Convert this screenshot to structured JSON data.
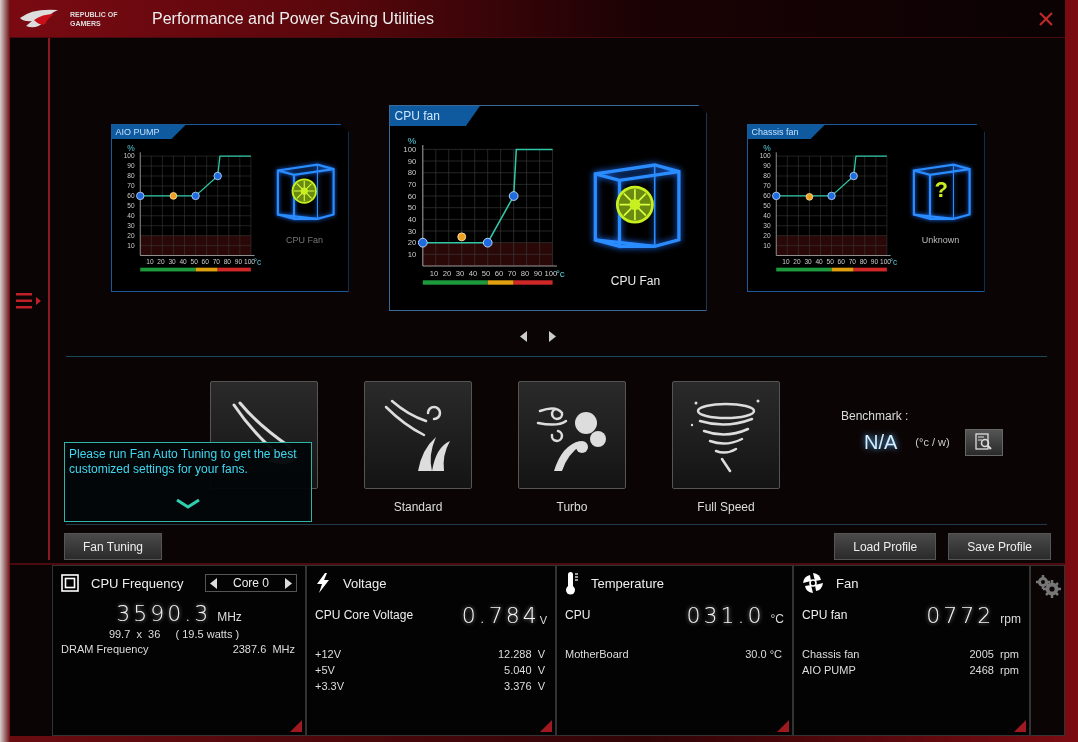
{
  "window": {
    "title": "Performance and Power Saving Utilities",
    "brand": "REPUBLIC OF GAMERS"
  },
  "fan_cards": [
    {
      "title": "AIO PUMP",
      "selected": false,
      "device": {
        "kind": "fan",
        "label": "CPU Fan",
        "dimmed": true
      },
      "chart_data": {
        "type": "line",
        "xlabel": "°c",
        "ylabel": "%",
        "grid": true,
        "x": [
          0,
          30,
          50,
          70,
          72,
          100
        ],
        "series": [
          {
            "color": "#2fc7a6",
            "values": [
              60,
              60,
              60,
              80,
              100,
              100
            ]
          },
          {
            "color": "#f0a020",
            "marker": true,
            "values": [
              null,
              60,
              null,
              null,
              null,
              null
            ]
          }
        ],
        "xlim": [
          0,
          100
        ],
        "ylim": [
          0,
          100
        ],
        "xticks": [
          10,
          20,
          30,
          40,
          50,
          60,
          70,
          80,
          90,
          100
        ],
        "yticks": [
          10,
          20,
          30,
          40,
          50,
          60,
          70,
          80,
          90,
          100
        ],
        "bands": [
          {
            "axis": "y",
            "from": 0,
            "to": 20,
            "color": "#2a0808"
          }
        ]
      }
    },
    {
      "title": "CPU fan",
      "selected": true,
      "device": {
        "kind": "fan",
        "label": "CPU Fan",
        "dimmed": false
      },
      "chart_data": {
        "type": "line",
        "xlabel": "°c",
        "ylabel": "%",
        "grid": true,
        "x": [
          0,
          30,
          50,
          70,
          72,
          100
        ],
        "series": [
          {
            "color": "#2fc7a6",
            "values": [
              20,
              20,
              20,
              60,
              100,
              100
            ]
          },
          {
            "color": "#f0a020",
            "marker": true,
            "values": [
              null,
              25,
              null,
              null,
              null,
              null
            ]
          }
        ],
        "xlim": [
          0,
          100
        ],
        "ylim": [
          0,
          100
        ],
        "xticks": [
          10,
          20,
          30,
          40,
          50,
          60,
          70,
          80,
          90,
          100
        ],
        "yticks": [
          10,
          20,
          30,
          40,
          50,
          60,
          70,
          80,
          90,
          100
        ],
        "bands": [
          {
            "axis": "y",
            "from": 0,
            "to": 20,
            "color": "#2a0808"
          }
        ]
      }
    },
    {
      "title": "Chassis fan",
      "selected": false,
      "device": {
        "kind": "unknown",
        "mark": "?",
        "label": "Unknown",
        "dimmed": false
      },
      "chart_data": {
        "type": "line",
        "xlabel": "°c",
        "ylabel": "%",
        "grid": true,
        "x": [
          0,
          30,
          50,
          70,
          72,
          100
        ],
        "series": [
          {
            "color": "#2fc7a6",
            "values": [
              60,
              60,
              60,
              80,
              100,
              100
            ]
          },
          {
            "color": "#f0a020",
            "marker": true,
            "values": [
              null,
              59,
              null,
              null,
              null,
              null
            ]
          }
        ],
        "xlim": [
          0,
          100
        ],
        "ylim": [
          0,
          100
        ],
        "xticks": [
          10,
          20,
          30,
          40,
          50,
          60,
          70,
          80,
          90,
          100
        ],
        "yticks": [
          10,
          20,
          30,
          40,
          50,
          60,
          70,
          80,
          90,
          100
        ],
        "bands": [
          {
            "axis": "y",
            "from": 0,
            "to": 20,
            "color": "#2a0808"
          }
        ]
      }
    }
  ],
  "modes": [
    {
      "kind": "silent"
    },
    {
      "kind": "standard",
      "label": "Standard"
    },
    {
      "kind": "turbo",
      "label": "Turbo"
    },
    {
      "kind": "full_speed",
      "label": "Full Speed"
    }
  ],
  "benchmark": {
    "label": "Benchmark :",
    "value": "N/A",
    "unit": "(°c / w)"
  },
  "tooltip": {
    "text": "Please run Fan Auto Tuning to get the best customized settings for your fans."
  },
  "left_buttons": [
    "Fan Tuning"
  ],
  "right_buttons": [
    "Load Profile",
    "Save Profile"
  ],
  "monitor": [
    {
      "kind": "frequency",
      "title": "CPU Frequency",
      "core": "Core 0",
      "value": "3590.3",
      "unit": "MHz",
      "detail": "99.7  x  36     ( 19.5 watts )",
      "rows": [
        {
          "label": "DRAM Frequency",
          "value": "2387.6  MHz"
        }
      ]
    },
    {
      "kind": "voltage",
      "title": "Voltage",
      "label": "CPU Core Voltage",
      "value": "0.784",
      "unit": "V",
      "rows": [
        {
          "label": "+12V",
          "value": "12.288  V"
        },
        {
          "label": "+5V",
          "value": "5.040  V"
        },
        {
          "label": "+3.3V",
          "value": "3.376  V"
        }
      ]
    },
    {
      "kind": "temperature",
      "title": "Temperature",
      "label": "CPU",
      "value": "031.0",
      "unit": "°C",
      "rows": [
        {
          "label": "MotherBoard",
          "value": "30.0 °C"
        }
      ]
    },
    {
      "kind": "fan",
      "title": "Fan",
      "label": "CPU fan",
      "value": "0772",
      "unit": "rpm",
      "rows": [
        {
          "label": "Chassis fan",
          "value": "2005  rpm"
        },
        {
          "label": "AIO PUMP",
          "value": "2468  rpm"
        }
      ]
    }
  ]
}
